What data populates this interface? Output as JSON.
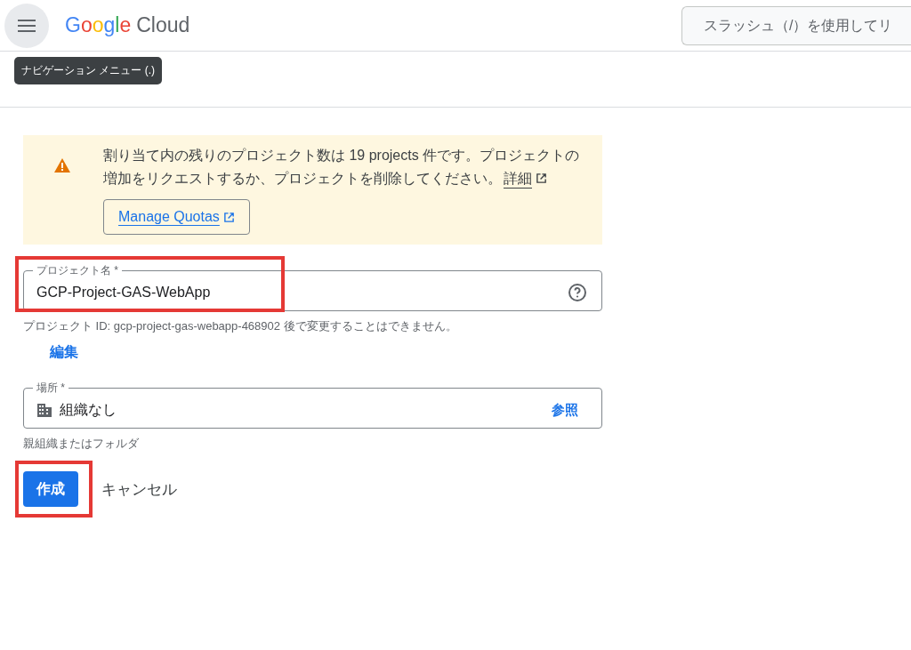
{
  "header": {
    "logo": {
      "brand": "Google",
      "product": "Cloud"
    },
    "search": {
      "placeholder": "スラッシュ（/）を使用してリ"
    }
  },
  "tooltip": "ナビゲーション メニュー (.)",
  "notice": {
    "message": "割り当て内の残りのプロジェクト数は 19 projects 件です。プロジェクトの増加をリクエストするか、プロジェクトを削除してください。",
    "link": "詳細",
    "button": "Manage Quotas"
  },
  "fields": [
    {
      "kind": "text",
      "label": "プロジェクト名 *",
      "value": "GCP-Project-GAS-WebApp",
      "helper": "プロジェクト ID: gcp-project-gas-webapp-468902 後で変更することはできません。",
      "helper_link": "編集"
    },
    {
      "kind": "picker",
      "label": "場所 *",
      "value": "組織なし",
      "action": "参照",
      "helper": "親組織またはフォルダ"
    }
  ],
  "buttons": {
    "primary": "作成",
    "secondary": "キャンセル"
  }
}
